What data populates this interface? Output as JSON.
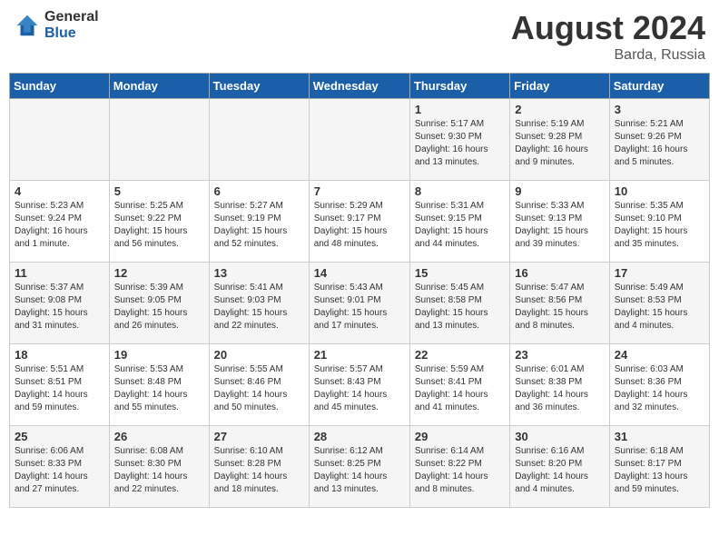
{
  "header": {
    "logo_general": "General",
    "logo_blue": "Blue",
    "month_title": "August 2024",
    "location": "Barda, Russia"
  },
  "weekdays": [
    "Sunday",
    "Monday",
    "Tuesday",
    "Wednesday",
    "Thursday",
    "Friday",
    "Saturday"
  ],
  "weeks": [
    [
      {
        "day": "",
        "info": ""
      },
      {
        "day": "",
        "info": ""
      },
      {
        "day": "",
        "info": ""
      },
      {
        "day": "",
        "info": ""
      },
      {
        "day": "1",
        "info": "Sunrise: 5:17 AM\nSunset: 9:30 PM\nDaylight: 16 hours\nand 13 minutes."
      },
      {
        "day": "2",
        "info": "Sunrise: 5:19 AM\nSunset: 9:28 PM\nDaylight: 16 hours\nand 9 minutes."
      },
      {
        "day": "3",
        "info": "Sunrise: 5:21 AM\nSunset: 9:26 PM\nDaylight: 16 hours\nand 5 minutes."
      }
    ],
    [
      {
        "day": "4",
        "info": "Sunrise: 5:23 AM\nSunset: 9:24 PM\nDaylight: 16 hours\nand 1 minute."
      },
      {
        "day": "5",
        "info": "Sunrise: 5:25 AM\nSunset: 9:22 PM\nDaylight: 15 hours\nand 56 minutes."
      },
      {
        "day": "6",
        "info": "Sunrise: 5:27 AM\nSunset: 9:19 PM\nDaylight: 15 hours\nand 52 minutes."
      },
      {
        "day": "7",
        "info": "Sunrise: 5:29 AM\nSunset: 9:17 PM\nDaylight: 15 hours\nand 48 minutes."
      },
      {
        "day": "8",
        "info": "Sunrise: 5:31 AM\nSunset: 9:15 PM\nDaylight: 15 hours\nand 44 minutes."
      },
      {
        "day": "9",
        "info": "Sunrise: 5:33 AM\nSunset: 9:13 PM\nDaylight: 15 hours\nand 39 minutes."
      },
      {
        "day": "10",
        "info": "Sunrise: 5:35 AM\nSunset: 9:10 PM\nDaylight: 15 hours\nand 35 minutes."
      }
    ],
    [
      {
        "day": "11",
        "info": "Sunrise: 5:37 AM\nSunset: 9:08 PM\nDaylight: 15 hours\nand 31 minutes."
      },
      {
        "day": "12",
        "info": "Sunrise: 5:39 AM\nSunset: 9:05 PM\nDaylight: 15 hours\nand 26 minutes."
      },
      {
        "day": "13",
        "info": "Sunrise: 5:41 AM\nSunset: 9:03 PM\nDaylight: 15 hours\nand 22 minutes."
      },
      {
        "day": "14",
        "info": "Sunrise: 5:43 AM\nSunset: 9:01 PM\nDaylight: 15 hours\nand 17 minutes."
      },
      {
        "day": "15",
        "info": "Sunrise: 5:45 AM\nSunset: 8:58 PM\nDaylight: 15 hours\nand 13 minutes."
      },
      {
        "day": "16",
        "info": "Sunrise: 5:47 AM\nSunset: 8:56 PM\nDaylight: 15 hours\nand 8 minutes."
      },
      {
        "day": "17",
        "info": "Sunrise: 5:49 AM\nSunset: 8:53 PM\nDaylight: 15 hours\nand 4 minutes."
      }
    ],
    [
      {
        "day": "18",
        "info": "Sunrise: 5:51 AM\nSunset: 8:51 PM\nDaylight: 14 hours\nand 59 minutes."
      },
      {
        "day": "19",
        "info": "Sunrise: 5:53 AM\nSunset: 8:48 PM\nDaylight: 14 hours\nand 55 minutes."
      },
      {
        "day": "20",
        "info": "Sunrise: 5:55 AM\nSunset: 8:46 PM\nDaylight: 14 hours\nand 50 minutes."
      },
      {
        "day": "21",
        "info": "Sunrise: 5:57 AM\nSunset: 8:43 PM\nDaylight: 14 hours\nand 45 minutes."
      },
      {
        "day": "22",
        "info": "Sunrise: 5:59 AM\nSunset: 8:41 PM\nDaylight: 14 hours\nand 41 minutes."
      },
      {
        "day": "23",
        "info": "Sunrise: 6:01 AM\nSunset: 8:38 PM\nDaylight: 14 hours\nand 36 minutes."
      },
      {
        "day": "24",
        "info": "Sunrise: 6:03 AM\nSunset: 8:36 PM\nDaylight: 14 hours\nand 32 minutes."
      }
    ],
    [
      {
        "day": "25",
        "info": "Sunrise: 6:06 AM\nSunset: 8:33 PM\nDaylight: 14 hours\nand 27 minutes."
      },
      {
        "day": "26",
        "info": "Sunrise: 6:08 AM\nSunset: 8:30 PM\nDaylight: 14 hours\nand 22 minutes."
      },
      {
        "day": "27",
        "info": "Sunrise: 6:10 AM\nSunset: 8:28 PM\nDaylight: 14 hours\nand 18 minutes."
      },
      {
        "day": "28",
        "info": "Sunrise: 6:12 AM\nSunset: 8:25 PM\nDaylight: 14 hours\nand 13 minutes."
      },
      {
        "day": "29",
        "info": "Sunrise: 6:14 AM\nSunset: 8:22 PM\nDaylight: 14 hours\nand 8 minutes."
      },
      {
        "day": "30",
        "info": "Sunrise: 6:16 AM\nSunset: 8:20 PM\nDaylight: 14 hours\nand 4 minutes."
      },
      {
        "day": "31",
        "info": "Sunrise: 6:18 AM\nSunset: 8:17 PM\nDaylight: 13 hours\nand 59 minutes."
      }
    ]
  ]
}
